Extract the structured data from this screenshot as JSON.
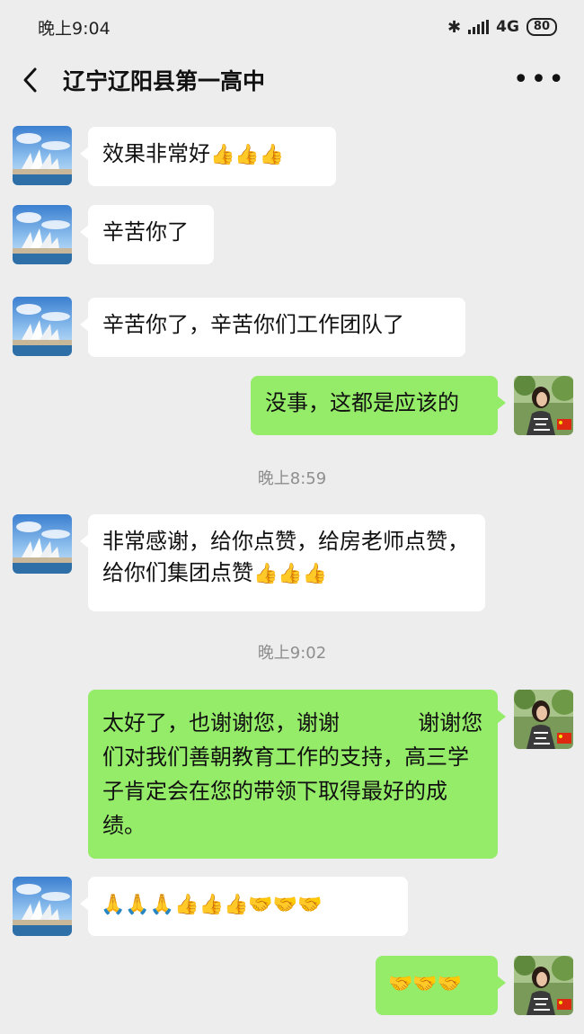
{
  "status_bar": {
    "time": "晚上9:04",
    "network": "4G",
    "battery": "80"
  },
  "chat": {
    "title": "辽宁辽阳县第一高中"
  },
  "messages": [
    {
      "from": "other",
      "text": "效果非常好",
      "emoji": "👍👍👍"
    },
    {
      "from": "other",
      "text": "辛苦你了"
    },
    {
      "from": "other",
      "text": "辛苦你了，辛苦你们工作团队了"
    },
    {
      "from": "me",
      "text": "没事，这都是应该的"
    },
    {
      "timestamp": "晚上8:59"
    },
    {
      "from": "other",
      "text": "非常感谢，给你点赞，给房老师点赞，给你们集团点赞",
      "emoji": "👍👍👍"
    },
    {
      "timestamp": "晚上9:02"
    },
    {
      "from": "me",
      "text": "太好了，也谢谢您，谢谢 　　　 谢谢您们对我们善朝教育工作的支持，高三学子肯定会在您的带领下取得最好的成绩。"
    },
    {
      "from": "other",
      "text": "",
      "emoji": "🙏🙏🙏👍👍👍🤝🤝🤝"
    },
    {
      "from": "me",
      "text": "",
      "emoji": "🤝🤝🤝"
    }
  ]
}
